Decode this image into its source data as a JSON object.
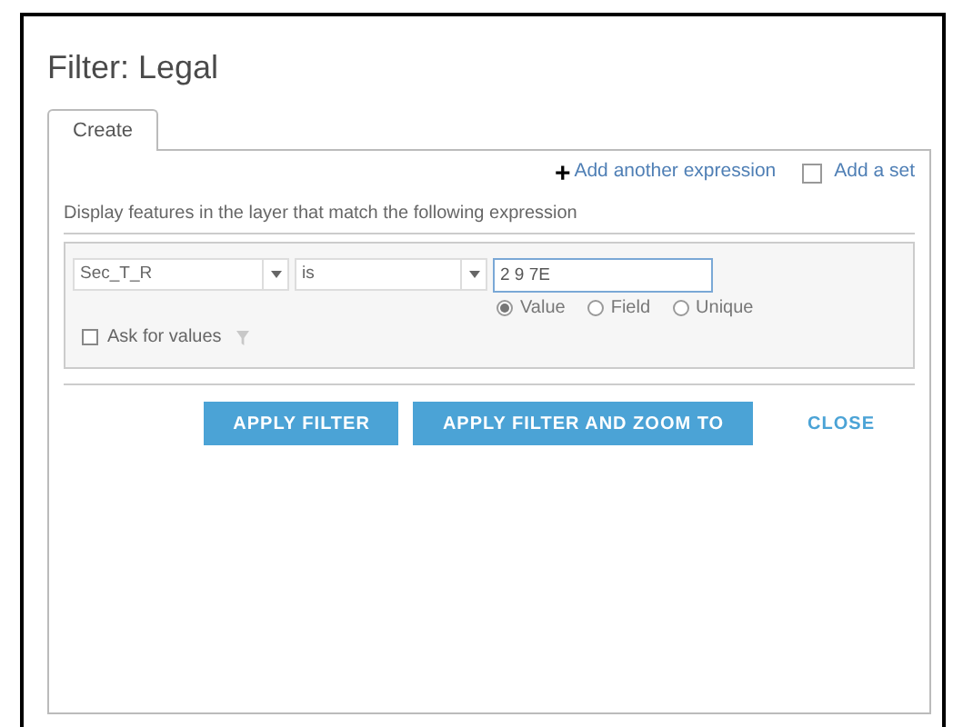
{
  "dialog": {
    "title": "Filter: Legal"
  },
  "tabs": [
    {
      "label": "Create",
      "selected": true
    }
  ],
  "add_expression": {
    "icon": "+",
    "label": "Add another expression"
  },
  "add_set": {
    "label": "Add a set",
    "checked": false
  },
  "description": "Display features in the layer that match the following expression",
  "expression": {
    "field": "Sec_T_R",
    "operator": "is",
    "value": "2 9 7E",
    "value_types": [
      {
        "label": "Value",
        "selected": true
      },
      {
        "label": "Field",
        "selected": false
      },
      {
        "label": "Unique",
        "selected": false
      }
    ],
    "ask_for_values": {
      "label": "Ask for values",
      "checked": false
    }
  },
  "buttons": [
    {
      "label": "APPLY FILTER",
      "kind": "primary"
    },
    {
      "label": "APPLY FILTER AND ZOOM TO",
      "kind": "primary"
    },
    {
      "label": "CLOSE",
      "kind": "link"
    }
  ]
}
